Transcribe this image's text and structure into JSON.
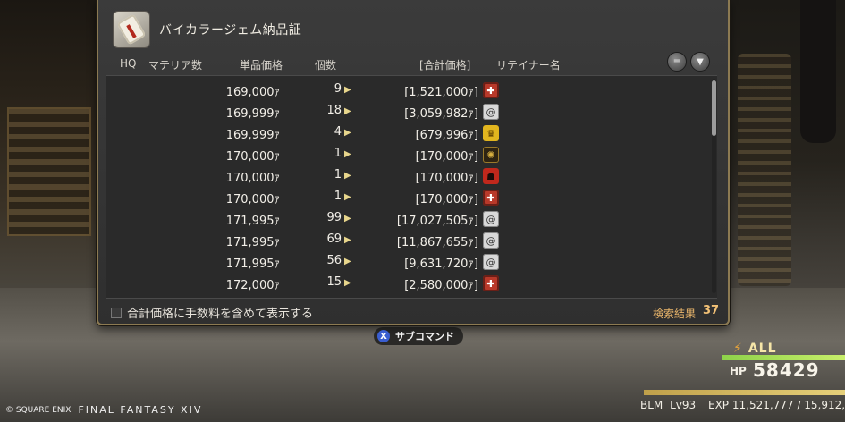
{
  "item": {
    "name": "バイカラージェム納品証",
    "icon": "scroll-icon"
  },
  "columns": {
    "hq": "HQ",
    "materia": "マテリア数",
    "unit_price": "単品価格",
    "quantity": "個数",
    "total": "[合計価格]",
    "retainer": "リテイナー名"
  },
  "listings": [
    {
      "price": "169,000ｧ",
      "qty": "9",
      "total": "[1,521,000ｧ]",
      "retainer_icon": "red-cross-emblem"
    },
    {
      "price": "169,999ｧ",
      "qty": "18",
      "total": "[3,059,982ｧ]",
      "retainer_icon": "swirl-emblem"
    },
    {
      "price": "169,999ｧ",
      "qty": "4",
      "total": "[679,996ｧ]",
      "retainer_icon": "yellow-emblem"
    },
    {
      "price": "170,000ｧ",
      "qty": "1",
      "total": "[170,000ｧ]",
      "retainer_icon": "dark-gold-emblem"
    },
    {
      "price": "170,000ｧ",
      "qty": "1",
      "total": "[170,000ｧ]",
      "retainer_icon": "red-face-emblem"
    },
    {
      "price": "170,000ｧ",
      "qty": "1",
      "total": "[170,000ｧ]",
      "retainer_icon": "red-cross-emblem"
    },
    {
      "price": "171,995ｧ",
      "qty": "99",
      "total": "[17,027,505ｧ]",
      "retainer_icon": "swirl-emblem"
    },
    {
      "price": "171,995ｧ",
      "qty": "69",
      "total": "[11,867,655ｧ]",
      "retainer_icon": "swirl-emblem"
    },
    {
      "price": "171,995ｧ",
      "qty": "56",
      "total": "[9,631,720ｧ]",
      "retainer_icon": "swirl-emblem"
    },
    {
      "price": "172,000ｧ",
      "qty": "15",
      "total": "[2,580,000ｧ]",
      "retainer_icon": "red-cross-emblem"
    }
  ],
  "footer": {
    "checkbox_label": "合計価格に手数料を含めて表示する",
    "result_label": "検索結果",
    "result_count": "37"
  },
  "subcommand": {
    "button": "X",
    "label": "サブコマンド"
  },
  "hud": {
    "target": "ALL",
    "hp_label": "HP",
    "hp_value": "58429",
    "job": "BLM",
    "level": "Lv93",
    "exp": "EXP 11,521,777 / 15,912,"
  },
  "copyright": {
    "publisher": "© SQUARE ENIX",
    "game": "FINAL FANTASY XIV"
  },
  "colors": {
    "frame": "#8c7a52",
    "result_accent": "#e8b46a",
    "hp_bar": "#8ed24a"
  }
}
